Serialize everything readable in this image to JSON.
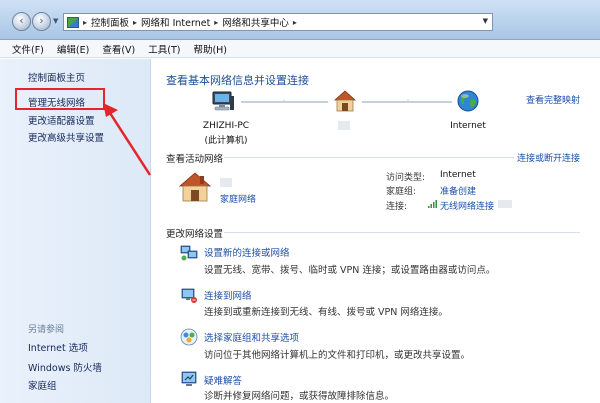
{
  "breadcrumb": [
    "控制面板",
    "网络和 Internet",
    "网络和共享中心"
  ],
  "menu": [
    "文件(F)",
    "编辑(E)",
    "查看(V)",
    "工具(T)",
    "帮助(H)"
  ],
  "sidebar": {
    "items": [
      "控制面板主页",
      "管理无线网络",
      "更改适配器设置",
      "更改高级共享设置"
    ],
    "see_also_title": "另请参阅",
    "see_also": [
      "Internet 选项",
      "Windows 防火墙",
      "家庭组"
    ]
  },
  "main": {
    "title": "查看基本网络信息并设置连接",
    "full_map_link": "查看完整映射",
    "nodes": {
      "computer": [
        "ZHIZHI-PC",
        "(此计算机)"
      ],
      "internet": "Internet"
    },
    "active_networks": {
      "heading": "查看活动网络",
      "connect_link": "连接或断开连接",
      "network_type": "家庭网络",
      "details": {
        "access_type_key": "访问类型:",
        "access_type_val": "Internet",
        "homegroup_key": "家庭组:",
        "homegroup_val": "准备创建",
        "connection_key": "连接:",
        "connection_val": "无线网络连接"
      }
    },
    "change_settings": {
      "heading": "更改网络设置",
      "tasks": [
        {
          "link": "设置新的连接或网络",
          "desc": "设置无线、宽带、拨号、临时或 VPN 连接；或设置路由器或访问点。",
          "icon": "network-setup-icon"
        },
        {
          "link": "连接到网络",
          "desc": "连接到或重新连接到无线、有线、拨号或 VPN 网络连接。",
          "icon": "connect-network-icon"
        },
        {
          "link": "选择家庭组和共享选项",
          "desc": "访问位于其他网络计算机上的文件和打印机，或更改共享设置。",
          "icon": "homegroup-icon"
        },
        {
          "link": "疑难解答",
          "desc": "诊断并修复网络问题，或获得故障排除信息。",
          "icon": "troubleshoot-icon"
        }
      ]
    }
  },
  "colors": {
    "link": "#1c4fa8",
    "title": "#1d4f91",
    "annotation": "#e3262b"
  }
}
